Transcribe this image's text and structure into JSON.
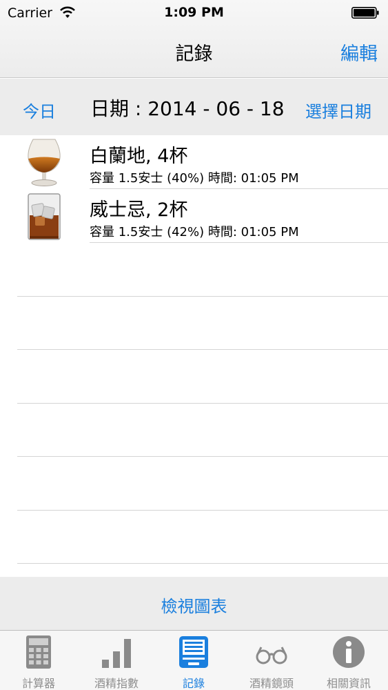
{
  "status": {
    "carrier": "Carrier",
    "time": "1:09 PM"
  },
  "nav": {
    "title": "記錄",
    "edit_label": "編輯"
  },
  "datebar": {
    "today_label": "今日",
    "date_text": "日期 : 2014 - 06 - 18",
    "choose_label": "選擇日期"
  },
  "records": [
    {
      "title": "白蘭地, 4杯",
      "detail": "容量 1.5安士 (40%) 時間: 01:05 PM",
      "icon": "brandy-glass-icon"
    },
    {
      "title": "威士忌, 2杯",
      "detail": "容量 1.5安士 (42%) 時間: 01:05 PM",
      "icon": "whisky-glass-icon"
    }
  ],
  "chart_button": "檢視圖表",
  "tabs": [
    {
      "label": "計算器",
      "icon": "calculator-icon",
      "active": false
    },
    {
      "label": "酒精指數",
      "icon": "bar-chart-icon",
      "active": false
    },
    {
      "label": "記錄",
      "icon": "records-icon",
      "active": true
    },
    {
      "label": "酒精鏡頭",
      "icon": "glasses-icon",
      "active": false
    },
    {
      "label": "相關資訊",
      "icon": "info-icon",
      "active": false
    }
  ],
  "colors": {
    "accent": "#1a7fde",
    "inactive_tab": "#8e8e8e",
    "bar_background": "#ececec"
  }
}
